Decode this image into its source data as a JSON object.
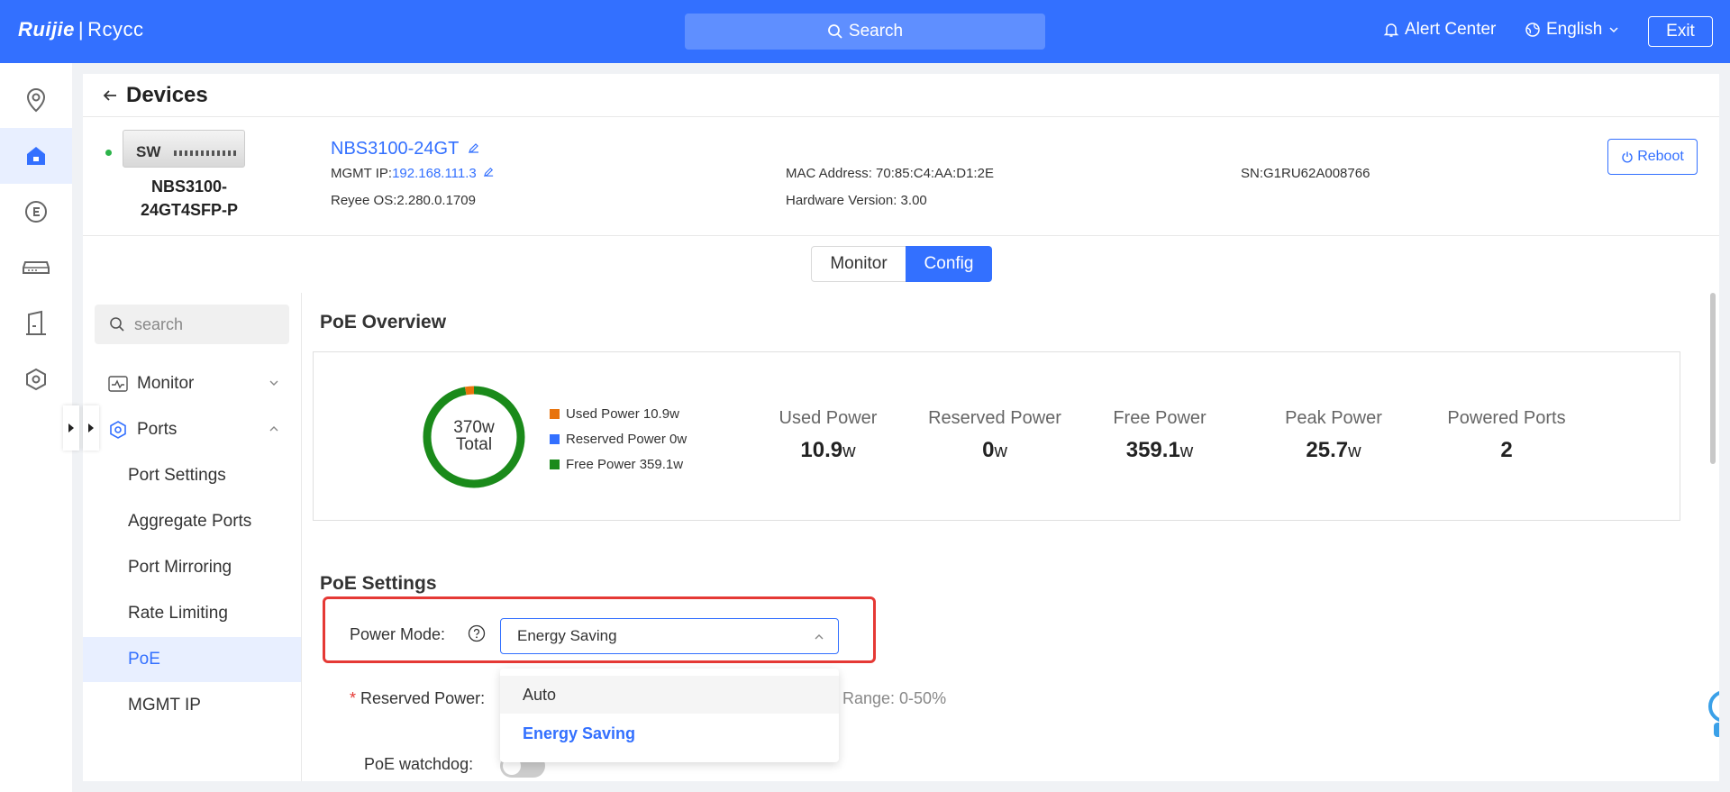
{
  "topbar": {
    "logo_brand": "Ruijie",
    "logo_sep": "|",
    "logo_product": "Rcycc",
    "search_label": "Search",
    "alert_center": "Alert Center",
    "language": "English",
    "exit": "Exit",
    "accent": "#3370ff"
  },
  "rail": {
    "icons": [
      "location-icon",
      "home-icon",
      "circle-e-icon",
      "device-icon",
      "building-icon",
      "hexagon-icon"
    ],
    "active_index": 1
  },
  "page": {
    "title": "Devices"
  },
  "device": {
    "image_label": "SW",
    "model": "NBS3100-24GT4SFP-P",
    "model_line1": "NBS3100-",
    "model_line2": "24GT4SFP-P",
    "name": "NBS3100-24GT",
    "mgmt_ip_label": "MGMT IP:",
    "mgmt_ip": "192.168.111.3",
    "os": "Reyee OS:2.280.0.1709",
    "mac": "MAC Address: 70:85:C4:AA:D1:2E",
    "hw": "Hardware Version: 3.00",
    "sn": "SN:G1RU62A008766",
    "reboot": "Reboot",
    "status_color": "#2cb34a"
  },
  "tabs": {
    "monitor": "Monitor",
    "config": "Config",
    "active": "Config"
  },
  "subnav": {
    "search_placeholder": "search",
    "groups": [
      {
        "label": "Monitor",
        "expanded": false
      },
      {
        "label": "Ports",
        "expanded": true
      }
    ],
    "items": [
      "Port Settings",
      "Aggregate Ports",
      "Port Mirroring",
      "Rate Limiting",
      "PoE",
      "MGMT IP"
    ],
    "active_item": "PoE"
  },
  "poe_overview": {
    "title": "PoE Overview",
    "donut_line1": "370w",
    "donut_line2": "Total",
    "legend": [
      {
        "label": "Used Power 10.9w",
        "color": "#e8730c"
      },
      {
        "label": "Reserved Power 0w",
        "color": "#3370ff"
      },
      {
        "label": "Free Power 359.1w",
        "color": "#1a8a1a"
      }
    ],
    "donut": {
      "total": 370,
      "used": 10.9,
      "reserved": 0,
      "free": 359.1
    },
    "stats": [
      {
        "label": "Used Power",
        "value": "10.9",
        "unit": "w"
      },
      {
        "label": "Reserved Power",
        "value": "0",
        "unit": "w"
      },
      {
        "label": "Free Power",
        "value": "359.1",
        "unit": "w"
      },
      {
        "label": "Peak Power",
        "value": "25.7",
        "unit": "w"
      },
      {
        "label": "Powered Ports",
        "value": "2",
        "unit": ""
      }
    ]
  },
  "poe_settings": {
    "title": "PoE Settings",
    "power_mode_label": "Power Mode:",
    "power_mode_value": "Energy Saving",
    "options": [
      "Auto",
      "Energy Saving"
    ],
    "selected_option": "Energy Saving",
    "reserved_power_required": "*",
    "reserved_power_label": "Reserved Power:",
    "reserved_power_range": "Range: 0-50%",
    "watchdog_label": "PoE watchdog:",
    "watchdog_on": false,
    "highlight_color": "#e53935"
  }
}
